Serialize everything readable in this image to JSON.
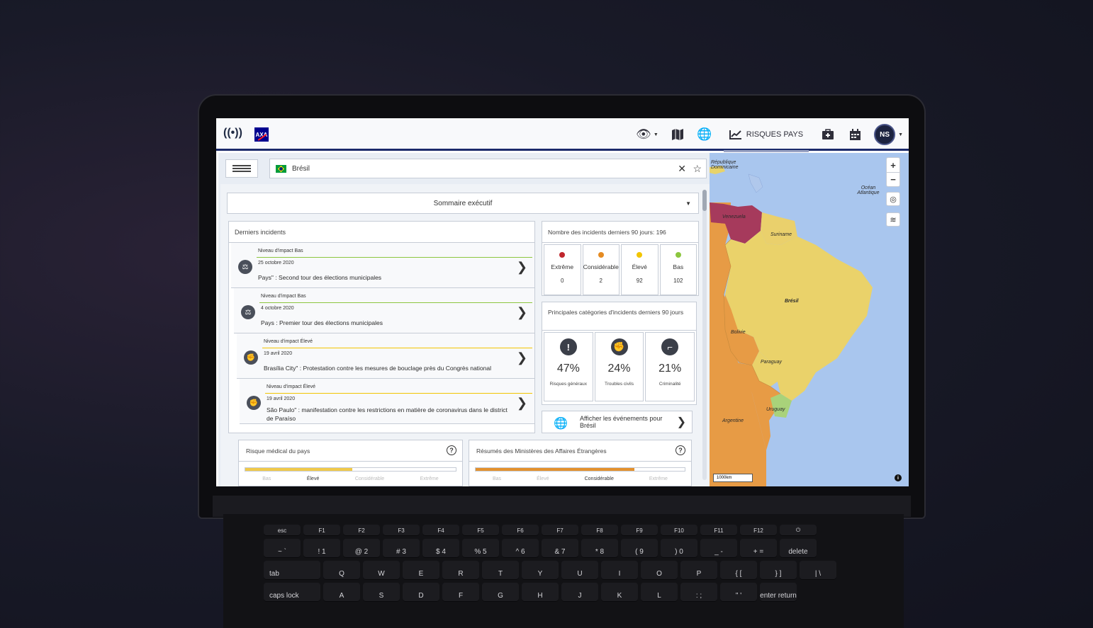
{
  "topbar": {
    "logo_text": "AXA",
    "risk_label": "RISQUES PAYS",
    "avatar_initials": "NS"
  },
  "search": {
    "value": "Brésil"
  },
  "summary": {
    "label": "Sommaire exécutif"
  },
  "incidents": {
    "header": "Derniers incidents",
    "items": [
      {
        "level": "Niveau d'impact Bas",
        "date": "25 octobre 2020",
        "title": "Pays\" : Second tour des élections municipales",
        "icon": "scales-icon",
        "color": "#8cc63f"
      },
      {
        "level": "Niveau d'impact Bas",
        "date": "4 octobre 2020",
        "title": "Pays : Premier tour des élections municipales",
        "icon": "scales-icon",
        "color": "#8cc63f"
      },
      {
        "level": "Niveau d'impact Élevé",
        "date": "19 avril 2020",
        "title": "Brasília City\" : Protestation contre les mesures de bouclage près du Congrès national",
        "icon": "protest-icon",
        "color": "#f2c500"
      },
      {
        "level": "Niveau d'impact Élevé",
        "date": "19 avril 2020",
        "title": "São Paulo\" : manifestation contre les restrictions en matière de coronavirus dans le district de Paraíso",
        "icon": "protest-icon",
        "color": "#f2c500"
      }
    ]
  },
  "counts": {
    "header": "Nombre des incidents derniers 90 jours: 196",
    "levels": [
      {
        "label": "Extrême",
        "value": "0",
        "color": "#c0262d"
      },
      {
        "label": "Considérable",
        "value": "2",
        "color": "#e58b22"
      },
      {
        "label": "Élevé",
        "value": "92",
        "color": "#f2c500"
      },
      {
        "label": "Bas",
        "value": "102",
        "color": "#8cc63f"
      }
    ]
  },
  "categories": {
    "header": "Principales catégories d'incidents derniers 90 jours",
    "items": [
      {
        "pct": "47%",
        "label": "Risques généraux",
        "icon": "exclamation-icon"
      },
      {
        "pct": "24%",
        "label": "Troubles civils",
        "icon": "protest-icon"
      },
      {
        "pct": "21%",
        "label": "Criminalité",
        "icon": "gun-icon"
      }
    ]
  },
  "events_button": {
    "label": "Afficher les événements pour Brésil"
  },
  "medical": {
    "header": "Risque médical du pays",
    "fill_pct": 51,
    "fill_color": "#f0c94a",
    "scale": [
      "Bas",
      "Élevé",
      "Considérable",
      "Extrême"
    ]
  },
  "affairs": {
    "header": "Résumés des Ministères des Affaires Étrangères",
    "fill_pct": 76,
    "fill_color": "#e3912e",
    "scale": [
      "Bas",
      "Élevé",
      "Considérable",
      "Extrême"
    ]
  },
  "map": {
    "labels": {
      "dominicana": "République Dominicaine",
      "ocean": "Océan Atlantique",
      "venezuela": "Venezuela",
      "suriname": "Suriname",
      "bresil": "Brésil",
      "bolivie": "Bolivie",
      "paraguay": "Paraguay",
      "uruguay": "Uruguay",
      "argentine": "Argentine"
    },
    "scale_label": "1000km",
    "zoom_in": "+",
    "zoom_out": "−"
  },
  "keyboard": {
    "row1": [
      "esc",
      "F1",
      "F2",
      "F3",
      "F4",
      "F5",
      "F6",
      "F7",
      "F8",
      "F9",
      "F10",
      "F11",
      "F12",
      "⏻"
    ],
    "row2": [
      "~ `",
      "! 1",
      "@ 2",
      "# 3",
      "$ 4",
      "% 5",
      "^ 6",
      "& 7",
      "* 8",
      "( 9",
      ") 0",
      "_ -",
      "+ =",
      "delete"
    ],
    "row3": [
      "tab",
      "Q",
      "W",
      "E",
      "R",
      "T",
      "Y",
      "U",
      "I",
      "O",
      "P",
      "{ [",
      "} ]",
      "| \\"
    ],
    "row4": [
      "caps lock",
      "A",
      "S",
      "D",
      "F",
      "G",
      "H",
      "J",
      "K",
      "L",
      ": ;",
      "\" '",
      "enter return"
    ]
  }
}
